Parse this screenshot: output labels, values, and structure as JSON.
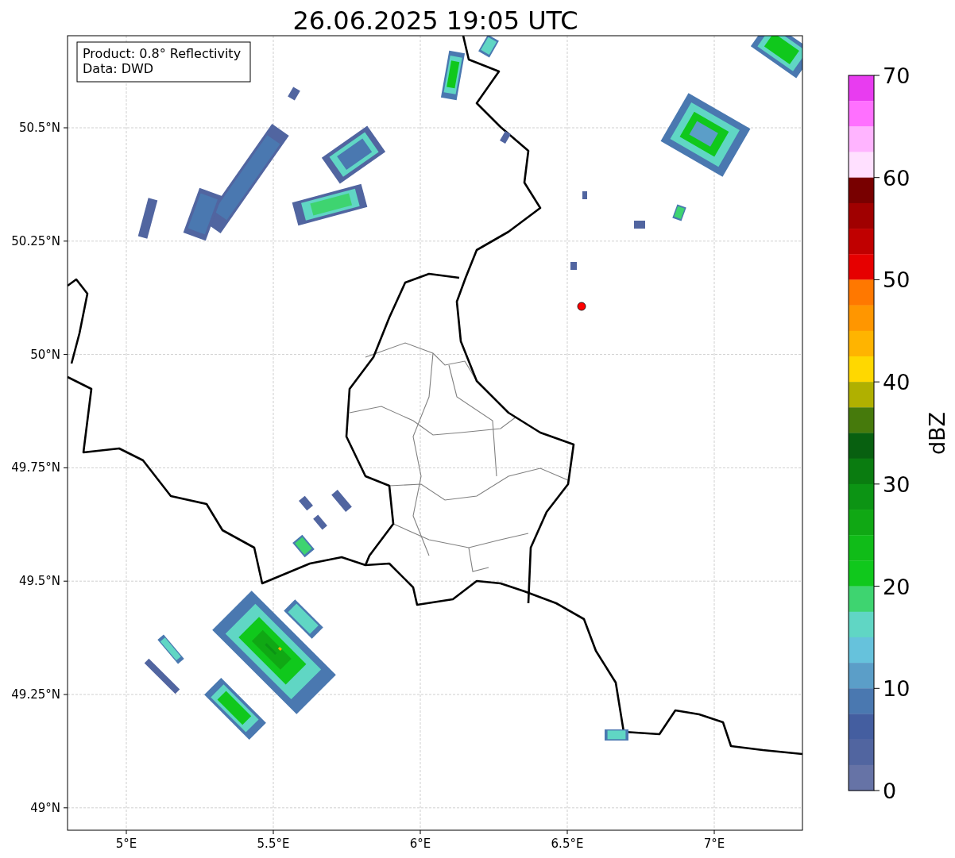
{
  "title": "26.06.2025 19:05 UTC",
  "legend": [
    "Product: 0.8° Reflectivity",
    "Data: DWD"
  ],
  "lat_ticks": [
    "50.5°N",
    "50.25°N",
    "50°N",
    "49.75°N",
    "49.5°N",
    "49.25°N",
    "49°N"
  ],
  "lon_ticks": [
    "5°E",
    "5.5°E",
    "6°E",
    "6.5°E",
    "7°E"
  ],
  "colorbar": {
    "label": "dBZ",
    "ticks": [
      "70",
      "60",
      "50",
      "40",
      "30",
      "20",
      "10",
      "0"
    ],
    "segments": [
      {
        "color": "#e83cf0"
      },
      {
        "color": "#ff70ff"
      },
      {
        "color": "#ffb4ff"
      },
      {
        "color": "#ffe0ff"
      },
      {
        "color": "#780000"
      },
      {
        "color": "#a00000"
      },
      {
        "color": "#c00000"
      },
      {
        "color": "#e60000"
      },
      {
        "color": "#ff7800"
      },
      {
        "color": "#ff9600"
      },
      {
        "color": "#ffb400"
      },
      {
        "color": "#ffd800"
      },
      {
        "color": "#b0b000"
      },
      {
        "color": "#467a0c"
      },
      {
        "color": "#086010"
      },
      {
        "color": "#0a7c10"
      },
      {
        "color": "#0c9414"
      },
      {
        "color": "#10a814"
      },
      {
        "color": "#10bc18"
      },
      {
        "color": "#10c81c"
      },
      {
        "color": "#3ed470"
      },
      {
        "color": "#60d6c4"
      },
      {
        "color": "#66c2dc"
      },
      {
        "color": "#5b9ec8"
      },
      {
        "color": "#4a78b0"
      },
      {
        "color": "#445ea0"
      },
      {
        "color": "#5165a0"
      },
      {
        "color": "#6673a6"
      }
    ]
  }
}
